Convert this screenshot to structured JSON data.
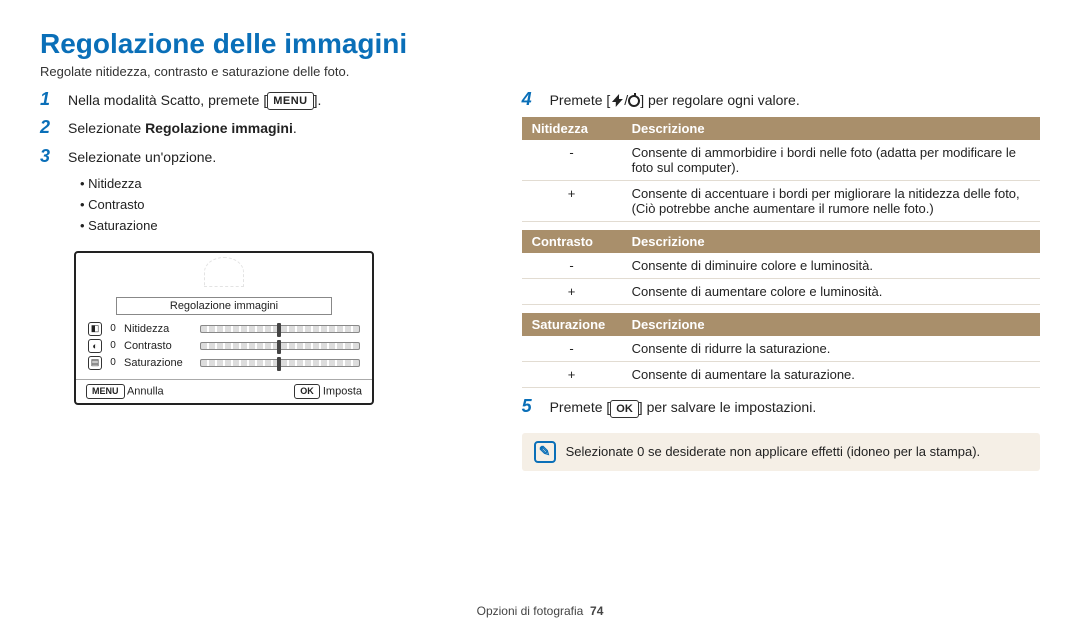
{
  "title": "Regolazione delle immagini",
  "subtitle": "Regolate nitidezza, contrasto e saturazione delle foto.",
  "steps": {
    "s1": {
      "num": "1",
      "text_a": "Nella modalità Scatto, premete [",
      "text_b": "].",
      "btn": "MENU"
    },
    "s2": {
      "num": "2",
      "text_a": "Selezionate ",
      "bold": "Regolazione immagini",
      "text_b": "."
    },
    "s3": {
      "num": "3",
      "text": "Selezionate un'opzione."
    },
    "s4": {
      "num": "4",
      "text_a": "Premete [",
      "text_b": "/",
      "text_c": "] per regolare ogni valore."
    },
    "s5": {
      "num": "5",
      "text_a": "Premete [",
      "btn": "OK",
      "text_b": "] per salvare le impostazioni."
    }
  },
  "bullets": [
    "Nitidezza",
    "Contrasto",
    "Saturazione"
  ],
  "camera": {
    "title": "Regolazione immagini",
    "rows": [
      {
        "icon": "◧",
        "val": "0",
        "label": "Nitidezza"
      },
      {
        "icon": "◐",
        "val": "0",
        "label": "Contrasto"
      },
      {
        "icon": "▤",
        "val": "0",
        "label": "Saturazione"
      }
    ],
    "cancel_btn": "MENU",
    "cancel": "Annulla",
    "ok_btn": "OK",
    "ok": "Imposta"
  },
  "tables": {
    "t1": {
      "h1": "Nitidezza",
      "h2": "Descrizione",
      "rows": [
        {
          "k": "-",
          "v": "Consente di ammorbidire i bordi nelle foto (adatta per modificare le foto sul computer)."
        },
        {
          "k": "+",
          "v": "Consente di accentuare i bordi per migliorare la nitidezza delle foto, (Ciò potrebbe anche aumentare il rumore nelle foto.)"
        }
      ]
    },
    "t2": {
      "h1": "Contrasto",
      "h2": "Descrizione",
      "rows": [
        {
          "k": "-",
          "v": "Consente di diminuire colore e luminosità."
        },
        {
          "k": "+",
          "v": "Consente di aumentare colore e luminosità."
        }
      ]
    },
    "t3": {
      "h1": "Saturazione",
      "h2": "Descrizione",
      "rows": [
        {
          "k": "-",
          "v": "Consente di ridurre la saturazione."
        },
        {
          "k": "+",
          "v": "Consente di aumentare la saturazione."
        }
      ]
    }
  },
  "note": "Selezionate 0 se desiderate non applicare effetti (idoneo per la stampa).",
  "footer": {
    "section": "Opzioni di fotografia",
    "page": "74"
  }
}
